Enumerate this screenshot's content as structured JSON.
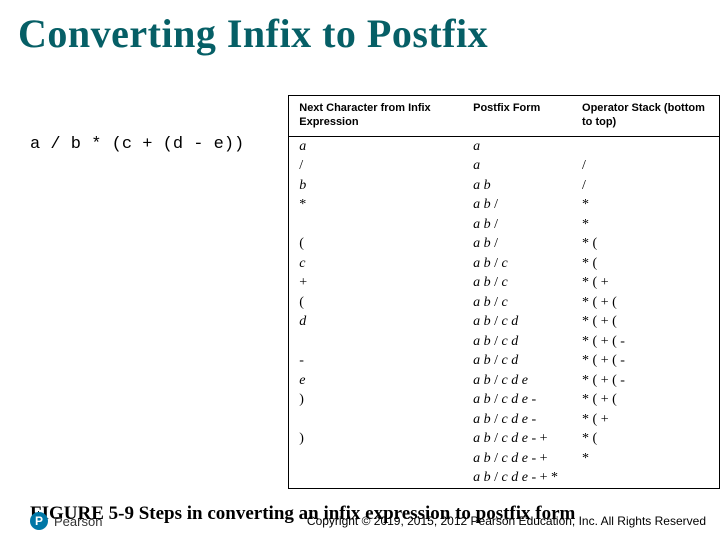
{
  "title": "Converting Infix to Postfix",
  "expression": "a / b * (c + (d - e))",
  "table": {
    "headers": [
      "Next Character\nfrom Infix\nExpression",
      "Postfix\nForm",
      "Operator Stack\n(bottom to top)"
    ],
    "rows": [
      {
        "next": "a",
        "postfix": "a",
        "stack": ""
      },
      {
        "next": "/",
        "postfix": "a",
        "stack": "/"
      },
      {
        "next": "b",
        "postfix": "a b",
        "stack": "/"
      },
      {
        "next": "*",
        "postfix": "a b /",
        "stack": "*"
      },
      {
        "next": "",
        "postfix": "a b /",
        "stack": "*"
      },
      {
        "next": "(",
        "postfix": "a b /",
        "stack": "* ("
      },
      {
        "next": "c",
        "postfix": "a b / c",
        "stack": "* ("
      },
      {
        "next": "+",
        "postfix": "a b / c",
        "stack": "* ( +"
      },
      {
        "next": "(",
        "postfix": "a b / c",
        "stack": "* ( + ("
      },
      {
        "next": "d",
        "postfix": "a b / c d",
        "stack": "* ( + ("
      },
      {
        "next": "",
        "postfix": "a b / c d",
        "stack": "* ( + ( -"
      },
      {
        "next": "-",
        "postfix": "a b / c d",
        "stack": "* ( + ( -"
      },
      {
        "next": "e",
        "postfix": "a b / c d e",
        "stack": "* ( + ( -"
      },
      {
        "next": ")",
        "postfix": "a b / c d e -",
        "stack": "* ( + ("
      },
      {
        "next": "",
        "postfix": "a b / c d e -",
        "stack": "* ( +"
      },
      {
        "next": ")",
        "postfix": "a b / c d e - +",
        "stack": "* ("
      },
      {
        "next": "",
        "postfix": "a b / c d e - +",
        "stack": "*"
      },
      {
        "next": "",
        "postfix": "a b / c d e - + *",
        "stack": ""
      }
    ]
  },
  "caption": "FIGURE 5-9 Steps in converting an infix expression to postfix form",
  "brand": {
    "mark": "P",
    "name": "Pearson"
  },
  "copyright": "Copyright © 2019, 2015, 2012 Pearson Education, Inc. All Rights Reserved"
}
